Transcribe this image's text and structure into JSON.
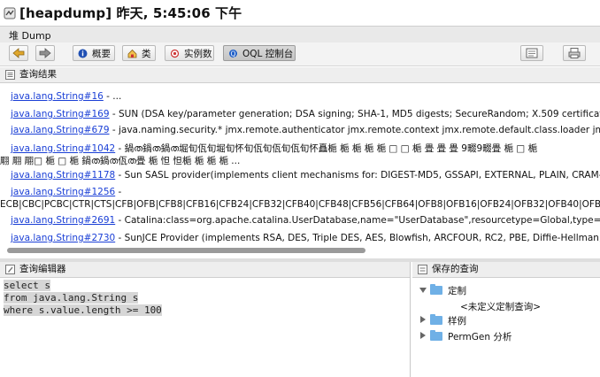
{
  "window": {
    "title": "[heapdump] 昨天, 5:45:06 下午"
  },
  "tab": {
    "label": "堆 Dump"
  },
  "toolbar": {
    "overview_label": "概要",
    "classes_label": "类",
    "instances_label": "实例数",
    "oql_label": "OQL 控制台"
  },
  "results": {
    "header": "查询结果",
    "rows": [
      {
        "link": "java.lang.String#16",
        "text": " - ..."
      },
      {
        "link": "java.lang.String#169",
        "text": " - SUN (DSA key/parameter generation; DSA signing; SHA-1, MD5 digests; SecureRandom; X.509 certificat"
      },
      {
        "link": "java.lang.String#679",
        "text": " - java.naming.security.* jmx.remote.authenticator jmx.remote.context jmx.remote.default.class.loader jm"
      },
      {
        "link": "java.lang.String#1042",
        "text": " - 鍋ത鍋ത鍋ത堀旬佤旬堀旬怀旬佤旬佤旬佤旬怀矗梔  梔    梔  梔  梔 □ □ 梔     畳    畳 畳 9畷9畷畳 梔 □ 梔",
        "text2": "翢    翢    翢□ 梔 □ 梔 鍋ത鍋ത佤ത畳 梔    怛  怛梔 梔 梔 梔 ..."
      },
      {
        "link": "java.lang.String#1178",
        "text": " - Sun SASL provider(implements client mechanisms for: DIGEST-MD5, GSSAPI, EXTERNAL, PLAIN, CRAM-"
      },
      {
        "link": "java.lang.String#1256",
        "text": " -",
        "text2": "ECB|CBC|PCBC|CTR|CTS|CFB|OFB|CFB8|CFB16|CFB24|CFB32|CFB40|CFB48|CFB56|CFB64|OFB8|OFB16|OFB24|OFB32|OFB40|OFB"
      },
      {
        "link": "java.lang.String#2691",
        "text": " - Catalina:class=org.apache.catalina.UserDatabase,name=\"UserDatabase\",resourcetype=Global,type=Re"
      },
      {
        "link": "java.lang.String#2730",
        "text": " - SunJCE Provider (implements RSA, DES, Triple DES, AES, Blowfish, ARCFOUR, RC2, PBE, Diffie-Hellman, "
      }
    ]
  },
  "editor": {
    "header": "查询编辑器",
    "lines": [
      "select s",
      "from java.lang.String s",
      "where s.value.length >= 100"
    ]
  },
  "saved": {
    "header": "保存的查询",
    "items": [
      {
        "label": "定制"
      },
      {
        "label": "<未定义定制查询>"
      },
      {
        "label": "样例"
      },
      {
        "label": "PermGen 分析"
      }
    ]
  },
  "colors": {
    "link": "#1a3fd6",
    "folder": "#6fb0e6",
    "selection": "#d6d6d6"
  }
}
